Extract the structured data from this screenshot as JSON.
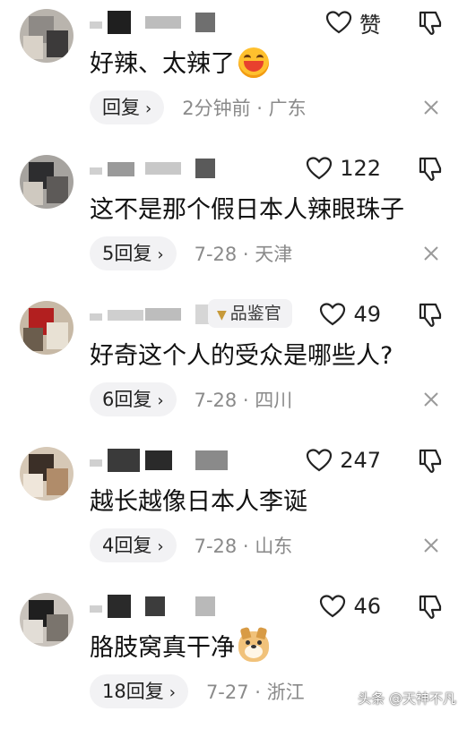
{
  "comments": [
    {
      "text": "好辣、太辣了",
      "emoji": "laughing-face",
      "like_label": "赞",
      "reply_label": "回复",
      "meta": "2分钟前 · 广东",
      "badge": null
    },
    {
      "text": "这不是那个假日本人辣眼珠子",
      "like_label": "122",
      "reply_label": "5回复",
      "meta": "7-28 · 天津",
      "badge": null
    },
    {
      "text": "好奇这个人的受众是哪些人?",
      "like_label": "49",
      "reply_label": "6回复",
      "meta": "7-28 · 四川",
      "badge": "品鉴官"
    },
    {
      "text": "越长越像日本人李诞",
      "like_label": "247",
      "reply_label": "4回复",
      "meta": "7-28 · 山东",
      "badge": null
    },
    {
      "text": "胳肢窝真干净",
      "emoji": "dog-face",
      "like_label": "46",
      "reply_label": "18回复",
      "meta": "7-27 · 浙江",
      "badge": null
    }
  ],
  "watermark": "头条 @天神不凡",
  "icons": {
    "like": "heart-outline-icon",
    "dislike": "thumbs-down-outline-icon",
    "close": "close-x-icon",
    "reply_chevron": "chevron-right-icon"
  },
  "colors": {
    "text": "#111111",
    "meta": "#8a8a8a",
    "pill_bg": "#f2f2f4"
  }
}
